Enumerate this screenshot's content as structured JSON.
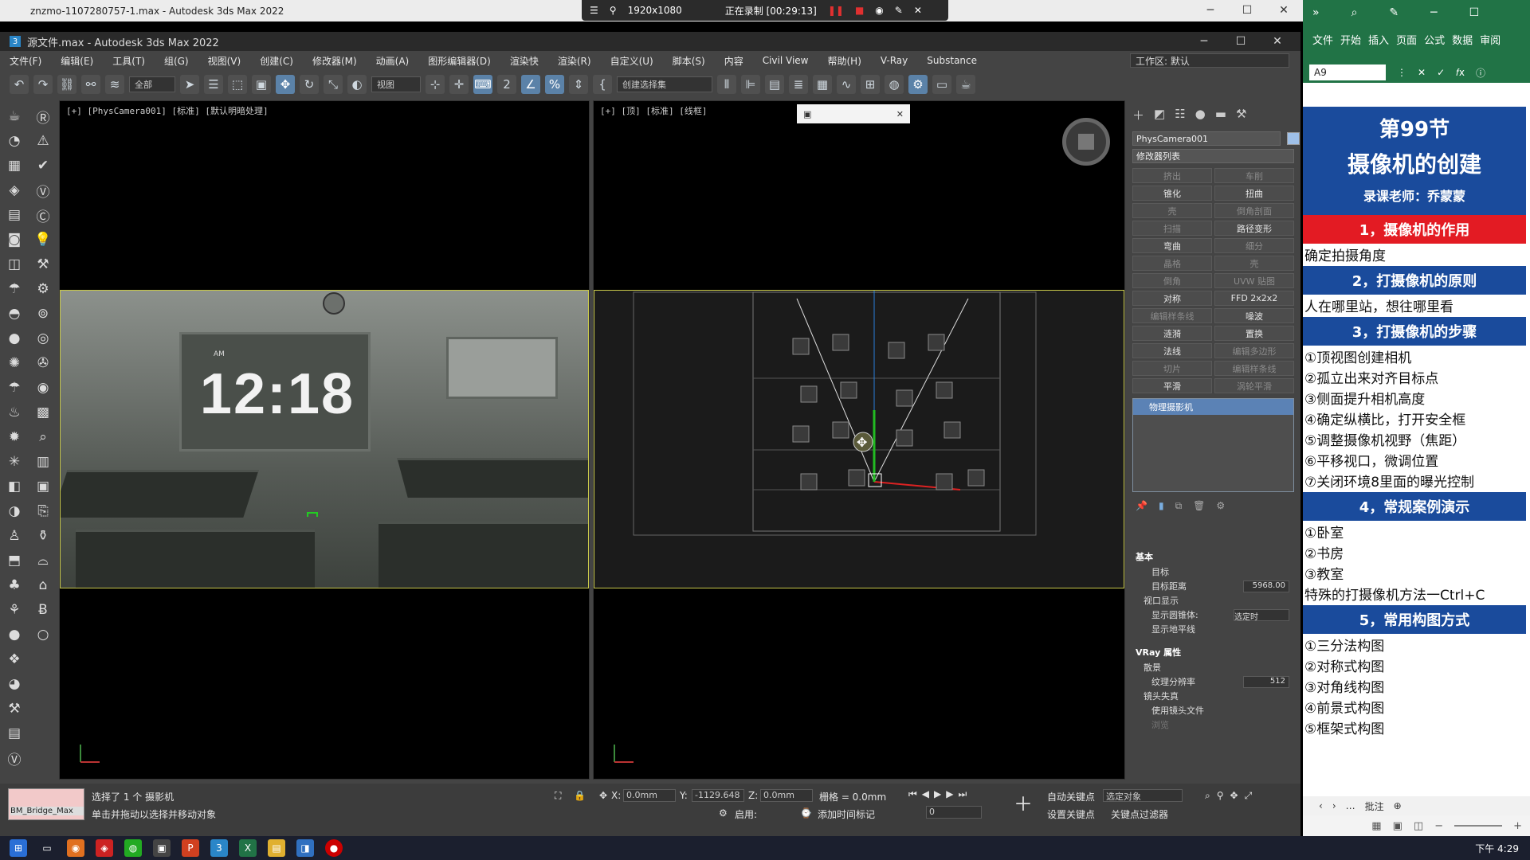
{
  "outer_window": {
    "title": "znzmo-1107280757-1.max - Autodesk 3ds Max 2022"
  },
  "recorder": {
    "resolution": "1920x1080",
    "status": "正在录制 [00:29:13]"
  },
  "app": {
    "title": "源文件.max - Autodesk 3ds Max 2022",
    "menu": [
      "文件(F)",
      "编辑(E)",
      "工具(T)",
      "组(G)",
      "视图(V)",
      "创建(C)",
      "修改器(M)",
      "动画(A)",
      "图形编辑器(D)",
      "渲染快",
      "渲染(R)",
      "自定义(U)",
      "脚本(S)",
      "内容",
      "Civil View",
      "帮助(H)",
      "V-Ray",
      "Substance"
    ],
    "workspace_label": "工作区: 默认",
    "toolbar": {
      "selection_filter": "全部",
      "ref_coord": "视图",
      "named_selection": "创建选择集"
    }
  },
  "viewports": {
    "left_label": "[+] [PhysCamera001] [标准] [默认明暗处理]",
    "right_label": "[+] [顶] [标准] [线框]",
    "clock_time": "12:18",
    "clock_am": "AM"
  },
  "command_panel": {
    "object_name": "PhysCamera001",
    "object_color": "#9fc0e8",
    "modifier_list": "修改器列表",
    "modifiers": [
      {
        "label": "挤出",
        "dim": true
      },
      {
        "label": "车削",
        "dim": true
      },
      {
        "label": "锥化",
        "dim": false
      },
      {
        "label": "扭曲",
        "dim": false
      },
      {
        "label": "壳",
        "dim": true
      },
      {
        "label": "倒角剖面",
        "dim": true
      },
      {
        "label": "扫描",
        "dim": true
      },
      {
        "label": "路径变形",
        "dim": false
      },
      {
        "label": "弯曲",
        "dim": false
      },
      {
        "label": "细分",
        "dim": true
      },
      {
        "label": "晶格",
        "dim": true
      },
      {
        "label": "壳",
        "dim": true
      },
      {
        "label": "倒角",
        "dim": true
      },
      {
        "label": "UVW 贴图",
        "dim": true
      },
      {
        "label": "对称",
        "dim": false
      },
      {
        "label": "FFD 2x2x2",
        "dim": false
      },
      {
        "label": "编辑样条线",
        "dim": true
      },
      {
        "label": "噪波",
        "dim": false
      },
      {
        "label": "涟漪",
        "dim": false
      },
      {
        "label": "置换",
        "dim": false
      },
      {
        "label": "法线",
        "dim": false
      },
      {
        "label": "编辑多边形",
        "dim": true
      },
      {
        "label": "切片",
        "dim": true
      },
      {
        "label": "编辑样条线",
        "dim": true
      },
      {
        "label": "平滑",
        "dim": false
      },
      {
        "label": "涡轮平滑",
        "dim": true
      }
    ],
    "stack_item": "物理摄影机",
    "basic": {
      "header": "基本",
      "target_label": "目标",
      "target_distance_label": "目标距离",
      "target_distance": "5968.00",
      "viewport_display": "视口显示",
      "show_cone_label": "显示圆锥体:",
      "show_cone_value": "选定时",
      "show_horizon": "显示地平线"
    },
    "vray": {
      "header": "VRay 属性",
      "bokeh": "散景",
      "texture_res_label": "纹理分辨率",
      "texture_res": "512",
      "lens_distortion": "镜头失真",
      "use_lens_file": "使用镜头文件",
      "browse": "浏览"
    }
  },
  "status": {
    "maxscript": "BM_Bridge_Max",
    "selection": "选择了 1 个 摄影机",
    "hint": "单击并拖动以选择并移动对象",
    "x_label": "X:",
    "x": "0.0mm",
    "y_label": "Y:",
    "y": "-1129.648",
    "z_label": "Z:",
    "z": "0.0mm",
    "grid": "栅格 = 0.0mm",
    "enable": "启用:",
    "add_time_tag": "添加时间标记",
    "auto_key": "自动关键点",
    "set_key": "设置关键点",
    "key_mode": "选定对象",
    "key_filters": "关键点过滤器",
    "frame": "0"
  },
  "excel": {
    "menu": [
      "文件",
      "开始",
      "插入",
      "页面",
      "公式",
      "数据",
      "审阅"
    ],
    "cell_ref": "A9",
    "title": "第99节",
    "subtitle": "摄像机的创建",
    "teacher": "录课老师：乔蒙蒙",
    "sections": [
      {
        "head": "1，摄像机的作用",
        "red": true,
        "items": [
          "确定拍摄角度"
        ]
      },
      {
        "head": "2，打摄像机的原则",
        "red": false,
        "items": [
          "人在哪里站，想往哪里看"
        ]
      },
      {
        "head": "3，打摄像机的步骤",
        "red": false,
        "items": [
          "①顶视图创建相机",
          "②孤立出来对齐目标点",
          "③侧面提升相机高度",
          "④确定纵横比，打开安全框",
          "⑤调整摄像机视野（焦距）",
          "⑥平移视口，微调位置",
          "⑦关闭环境8里面的曝光控制"
        ]
      },
      {
        "head": "4，常规案例演示",
        "red": false,
        "items": [
          "①卧室",
          "②书房",
          "③教室",
          "特殊的打摄像机方法一Ctrl+C"
        ]
      },
      {
        "head": "5，常用构图方式",
        "red": false,
        "items": [
          "①三分法构图",
          "②对称式构图",
          "③对角线构图",
          "④前景式构图",
          "⑤框架式构图"
        ]
      }
    ],
    "sheet_tab": "批注"
  },
  "taskbar": {
    "clock": "下午 4:29"
  }
}
